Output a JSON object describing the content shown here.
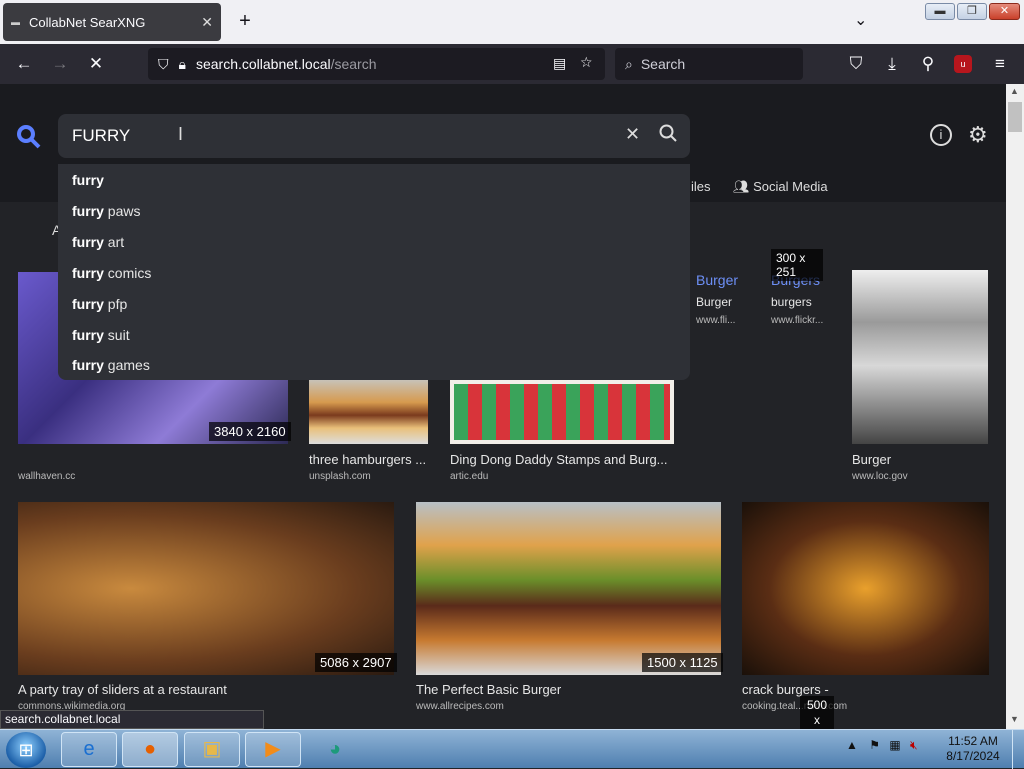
{
  "browser": {
    "tab_title": "CollabNet SearXNG",
    "url_host": "search.collabnet.local",
    "url_path": "/search",
    "search_placeholder": "Search"
  },
  "search": {
    "query": "FURRY",
    "suggestions": [
      {
        "bold": "furry",
        "rest": ""
      },
      {
        "bold": "furry",
        "rest": " paws"
      },
      {
        "bold": "furry",
        "rest": " art"
      },
      {
        "bold": "furry",
        "rest": " comics"
      },
      {
        "bold": "furry",
        "rest": " pfp"
      },
      {
        "bold": "furry",
        "rest": " suit"
      },
      {
        "bold": "furry",
        "rest": " games"
      }
    ]
  },
  "categories": {
    "files_partial": "iles",
    "social_media": "Social Media",
    "all_partial": "A"
  },
  "results": {
    "r1": {
      "dim": "3840 x 2160",
      "source": "wallhaven.cc"
    },
    "r2": {
      "title": "three hamburgers ...",
      "source": "unsplash.com"
    },
    "r3": {
      "title": "Ding Dong Daddy Stamps and Burg...",
      "source": "artic.edu"
    },
    "r4": {
      "title_link": "Burger",
      "title": "Burger",
      "source": "www.fli..."
    },
    "r5": {
      "dim_top": "300 x",
      "dim_bottom": "251",
      "title_link": "Burgers",
      "title": "burgers",
      "source": "www.flickr..."
    },
    "r6": {
      "title": "Burger",
      "source": "www.loc.gov"
    },
    "r7": {
      "dim": "5086 x 2907",
      "title": "A party tray of sliders at a restaurant",
      "source": "commons.wikimedia.org"
    },
    "r8": {
      "dim": "1500 x 1125",
      "title": "The Perfect Basic Burger",
      "source": "www.allrecipes.com"
    },
    "r9": {
      "dim_top": "500",
      "dim_bottom": "x",
      "title": "crack burgers -",
      "source": "cooking.teal...nomi.com"
    }
  },
  "status_url": "search.collabnet.local",
  "taskbar": {
    "time": "11:52 AM",
    "date": "8/17/2024"
  },
  "colors": {
    "accent": "#5b7fff",
    "page_bg": "#222327",
    "header_bg": "#1a1b1f",
    "input_bg": "#2e3036"
  }
}
